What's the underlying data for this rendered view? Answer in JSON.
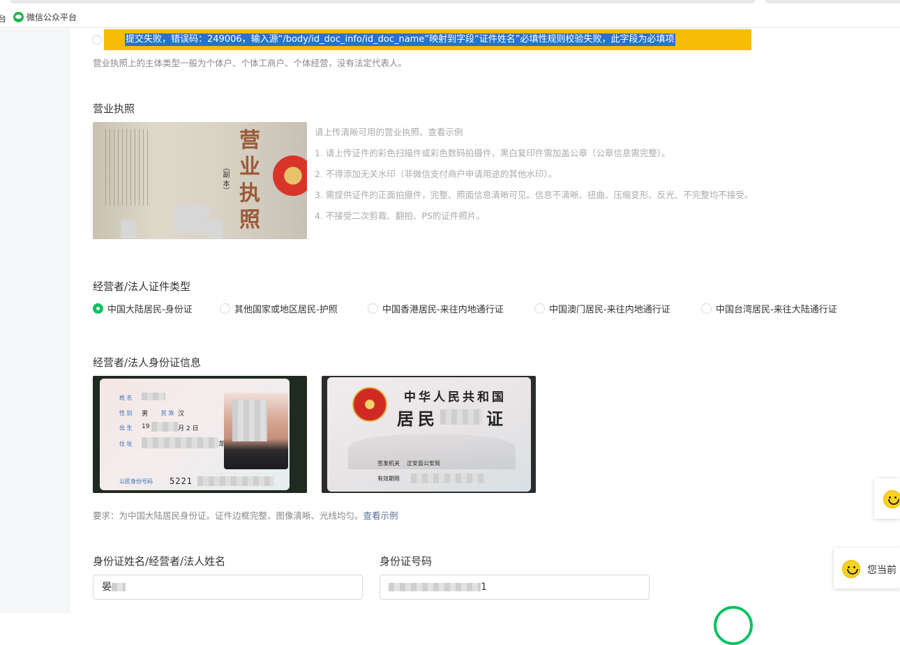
{
  "browser": {
    "bookmark_cut_text": "台",
    "bookmark_label": "微信公众平台"
  },
  "error": {
    "message": "提交失败，错误码：249006，输入源“/body/id_doc_info/id_doc_name”映射到字段“证件姓名”必填性规则校验失败，此字段为必填项"
  },
  "subject_note": "营业执照上的主体类型一般为个体户、个体工商户、个体经营，没有法定代表人。",
  "license_section": {
    "title": "营业执照",
    "photo_title_text": "营业执照",
    "photo_sub_text": "（副 本）",
    "help": [
      "请上传清晰可用的营业执照。查看示例",
      "1. 请上传证件的彩色扫描件或彩色数码拍摄件，黑白复印件需加盖公章（公章信息需完整）。",
      "2. 不得添加无关水印（非微信支付商户申请用途的其他水印）。",
      "3. 需提供证件的正面拍摄件，完整、照面信息清晰可见。信息不清晰、扭曲、压缩变形、反光、不完整均不接受。",
      "4. 不接受二次剪裁、翻拍、PS的证件照片。"
    ]
  },
  "id_type_section": {
    "title": "经营者/法人证件类型",
    "options": [
      {
        "label": "中国大陆居民-身份证",
        "checked": true
      },
      {
        "label": "其他国家或地区居民-护照",
        "checked": false
      },
      {
        "label": "中国香港居民-来往内地通行证",
        "checked": false
      },
      {
        "label": "中国澳门居民-来往内地通行证",
        "checked": false
      },
      {
        "label": "中国台湾居民-来往大陆通行证",
        "checked": false
      }
    ]
  },
  "id_info_section": {
    "title": "经营者/法人身份证信息",
    "front": {
      "name_label": "姓 名",
      "sex_label": "性 别",
      "sex_value": "男",
      "ethnic_label": "民 族",
      "ethnic_value": "汉",
      "birth_label": "出 生",
      "birth_value_start": "19",
      "birth_value_end": "月 2 日",
      "address_label": "住 址",
      "address_value_end": "龙光",
      "id_label": "公民身份号码",
      "id_value_start": "5221"
    },
    "back": {
      "country": "中华人民共和国",
      "resident_start": "居民",
      "resident_end": "证",
      "issuer_label": "签发机关",
      "issuer_value": "正安县公安局",
      "valid_label": "有效期限"
    },
    "requirement_text": "要求：为中国大陆居民身份证。证件边框完整、图像清晰、光线均匀。",
    "requirement_link": "查看示例"
  },
  "fields": {
    "name_label": "身份证姓名/经营者/法人姓名",
    "name_value_visible": "晏",
    "id_number_label": "身份证号码",
    "id_number_value_visible": "1"
  },
  "floating": {
    "card2_text": "您当前"
  },
  "colors": {
    "accent_green": "#07c160",
    "error_banner": "#f7bd05",
    "selection_blue": "#2d6fd1",
    "link": "#576b95"
  }
}
